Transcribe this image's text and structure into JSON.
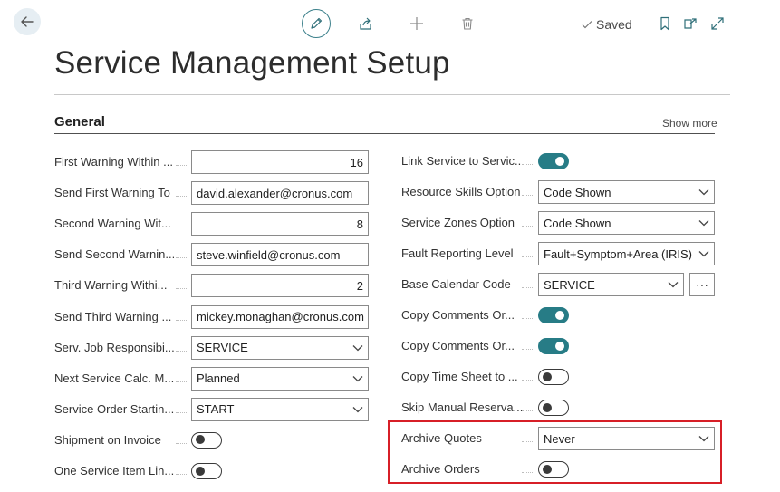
{
  "toolbar": {
    "saved_label": "Saved"
  },
  "page": {
    "title": "Service Management Setup"
  },
  "section": {
    "title": "General",
    "show_more": "Show more"
  },
  "left_fields": [
    {
      "label": "First Warning Within ...",
      "kind": "number",
      "value": "16"
    },
    {
      "label": "Send First Warning To",
      "kind": "text",
      "value": "david.alexander@cronus.com"
    },
    {
      "label": "Second Warning Wit...",
      "kind": "number",
      "value": "8"
    },
    {
      "label": "Send Second Warnin...",
      "kind": "text",
      "value": "steve.winfield@cronus.com"
    },
    {
      "label": "Third Warning Withi...",
      "kind": "number",
      "value": "2"
    },
    {
      "label": "Send Third Warning ...",
      "kind": "text",
      "value": "mickey.monaghan@cronus.com"
    },
    {
      "label": "Serv. Job Responsibi...",
      "kind": "lookup",
      "value": "SERVICE"
    },
    {
      "label": "Next Service Calc. M...",
      "kind": "select",
      "value": "Planned"
    },
    {
      "label": "Service Order Startin...",
      "kind": "lookup",
      "value": "START"
    },
    {
      "label": "Shipment on Invoice",
      "kind": "toggle",
      "value": "off"
    },
    {
      "label": "One Service Item Lin...",
      "kind": "toggle",
      "value": "off"
    }
  ],
  "right_fields": [
    {
      "label": "Link Service to Servic...",
      "kind": "toggle",
      "value": "on"
    },
    {
      "label": "Resource Skills Option",
      "kind": "select",
      "value": "Code Shown"
    },
    {
      "label": "Service Zones Option",
      "kind": "select",
      "value": "Code Shown"
    },
    {
      "label": "Fault Reporting Level",
      "kind": "select",
      "value": "Fault+Symptom+Area (IRIS)"
    },
    {
      "label": "Base Calendar Code",
      "kind": "lookup-ellipsis",
      "value": "SERVICE",
      "ellipsis": "···"
    },
    {
      "label": "Copy Comments Or...",
      "kind": "toggle",
      "value": "on"
    },
    {
      "label": "Copy Comments Or...",
      "kind": "toggle",
      "value": "on"
    },
    {
      "label": "Copy Time Sheet to ...",
      "kind": "toggle",
      "value": "off"
    },
    {
      "label": "Skip Manual Reserva...",
      "kind": "toggle",
      "value": "off"
    },
    {
      "label": "Archive Quotes",
      "kind": "select",
      "value": "Never"
    },
    {
      "label": "Archive Orders",
      "kind": "toggle",
      "value": "off"
    }
  ],
  "colors": {
    "accent": "#277c86",
    "highlight": "#d71f27"
  }
}
